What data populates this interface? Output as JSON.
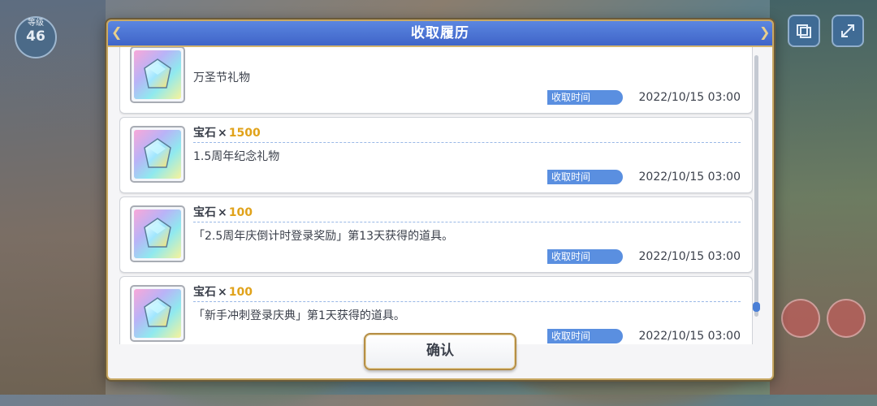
{
  "background": {
    "level_caption": "等级",
    "level_value": "46"
  },
  "dialog": {
    "title": "收取履历",
    "confirm_label": "确认"
  },
  "items": [
    {
      "name": "",
      "quantity": "",
      "desc": "万圣节礼物",
      "time_label": "收取时间",
      "time": "2022/10/15  03:00"
    },
    {
      "name": "宝石",
      "quantity": "1500",
      "desc": "1.5周年纪念礼物",
      "time_label": "收取时间",
      "time": "2022/10/15  03:00"
    },
    {
      "name": "宝石",
      "quantity": "100",
      "desc": "「2.5周年庆倒计时登录奖励」第13天获得的道具。",
      "time_label": "收取时间",
      "time": "2022/10/15  03:00"
    },
    {
      "name": "宝石",
      "quantity": "100",
      "desc": "「新手冲刺登录庆典」第1天获得的道具。",
      "time_label": "收取时间",
      "time": "2022/10/15  03:00"
    }
  ],
  "icons": {
    "item": "rainbow-gem-icon",
    "top_right_1": "window-icon",
    "top_right_2": "expand-icon"
  },
  "colors": {
    "header": "#4a74d6",
    "quantity": "#e0a21a",
    "time_label_bg": "#5a8fe0",
    "frame_gold": "#c9a964"
  },
  "scroll": {
    "position": 0.98
  }
}
